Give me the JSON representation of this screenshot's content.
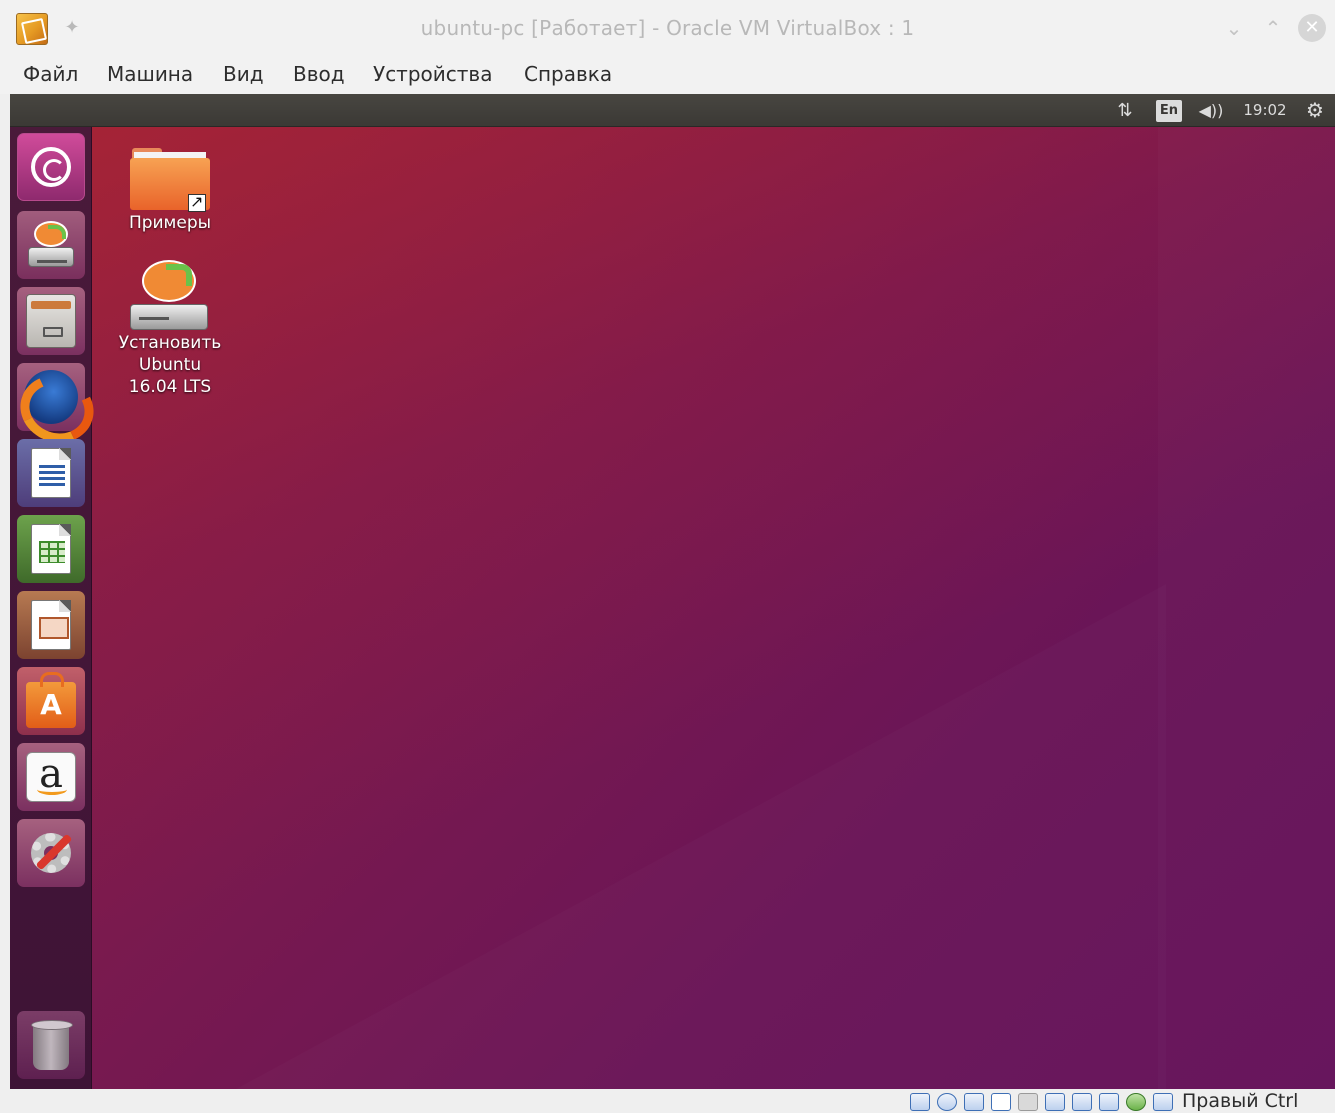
{
  "window": {
    "title": "ubuntu-pc [Работает] - Oracle VM VirtualBox : 1"
  },
  "menu": {
    "items": [
      "Файл",
      "Машина",
      "Вид",
      "Ввод",
      "Устройства",
      "Справка"
    ]
  },
  "panel": {
    "language": "En",
    "clock": "19:02",
    "icons": [
      "network-icon",
      "volume-icon",
      "settings-gear-icon"
    ]
  },
  "launcher": {
    "items": [
      "ubuntu-dash-icon",
      "install-ubuntu-icon",
      "file-manager-icon",
      "firefox-icon",
      "libreoffice-writer-icon",
      "libreoffice-calc-icon",
      "libreoffice-impress-icon",
      "software-center-icon",
      "amazon-icon",
      "system-settings-icon",
      "trash-icon"
    ]
  },
  "desktop": {
    "examples_label": "Примеры",
    "install_label": "Установить\nUbuntu\n16.04 LTS"
  },
  "statusbar": {
    "host_key": "Правый Ctrl"
  },
  "colors": {
    "ubuntu_aubergine": "#77216F",
    "ubuntu_orange": "#E95420",
    "panel_dark": "#3C3B37"
  }
}
